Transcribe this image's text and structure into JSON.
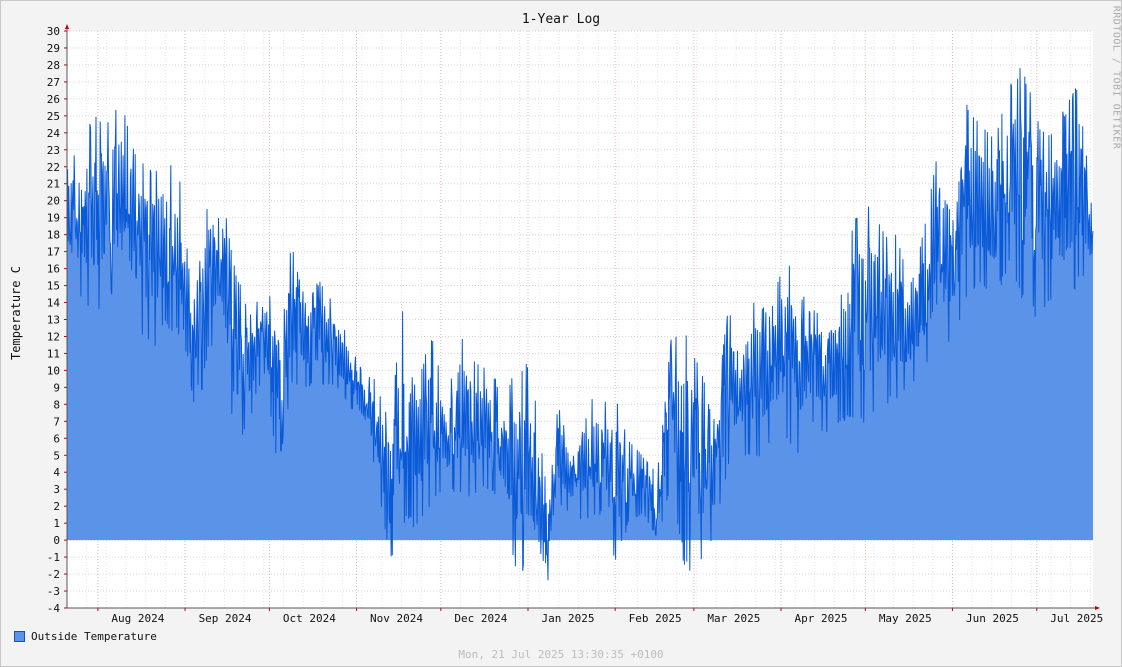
{
  "chart_data": {
    "type": "area",
    "title": "1-Year Log",
    "ylabel": "Temperature C",
    "xlabel": "",
    "ylim": [
      -4,
      30
    ],
    "yticks": [
      -4,
      -3,
      -2,
      -1,
      0,
      1,
      2,
      3,
      4,
      5,
      6,
      7,
      8,
      9,
      10,
      11,
      12,
      13,
      14,
      15,
      16,
      17,
      18,
      19,
      20,
      21,
      22,
      23,
      24,
      25,
      26,
      27,
      28,
      29,
      30
    ],
    "xlim": [
      "2024-07-21",
      "2025-07-21"
    ],
    "xticks": [
      {
        "label": "Aug 2024",
        "date": "2024-08-01"
      },
      {
        "label": "Sep 2024",
        "date": "2024-09-01"
      },
      {
        "label": "Oct 2024",
        "date": "2024-10-01"
      },
      {
        "label": "Nov 2024",
        "date": "2024-11-01"
      },
      {
        "label": "Dec 2024",
        "date": "2024-12-01"
      },
      {
        "label": "Jan 2025",
        "date": "2025-01-01"
      },
      {
        "label": "Feb 2025",
        "date": "2025-02-01"
      },
      {
        "label": "Mar 2025",
        "date": "2025-03-01"
      },
      {
        "label": "Apr 2025",
        "date": "2025-04-01"
      },
      {
        "label": "May 2025",
        "date": "2025-05-01"
      },
      {
        "label": "Jun 2025",
        "date": "2025-06-01"
      },
      {
        "label": "Jul 2025",
        "date": "2025-07-01"
      }
    ],
    "grid": true,
    "legend_position": "bottom-left",
    "series": [
      {
        "name": "Outside Temperature",
        "color": "#5b93e8",
        "line_color": "#0a5ad8",
        "points": [
          {
            "x": "2024-07-21",
            "min": 15.5,
            "max": 22.0
          },
          {
            "x": "2024-07-26",
            "min": 14.0,
            "max": 24.0
          },
          {
            "x": "2024-07-31",
            "min": 13.0,
            "max": 25.0
          },
          {
            "x": "2024-08-05",
            "min": 14.5,
            "max": 25.0
          },
          {
            "x": "2024-08-10",
            "min": 14.0,
            "max": 26.0
          },
          {
            "x": "2024-08-15",
            "min": 12.5,
            "max": 22.5
          },
          {
            "x": "2024-08-20",
            "min": 11.0,
            "max": 22.0
          },
          {
            "x": "2024-08-25",
            "min": 12.5,
            "max": 22.5
          },
          {
            "x": "2024-08-30",
            "min": 12.0,
            "max": 21.5
          },
          {
            "x": "2024-09-04",
            "min": 5.0,
            "max": 14.0
          },
          {
            "x": "2024-09-09",
            "min": 11.0,
            "max": 20.0
          },
          {
            "x": "2024-09-14",
            "min": 12.0,
            "max": 21.0
          },
          {
            "x": "2024-09-19",
            "min": 5.0,
            "max": 16.0
          },
          {
            "x": "2024-09-24",
            "min": 7.0,
            "max": 13.5
          },
          {
            "x": "2024-09-29",
            "min": 10.0,
            "max": 15.0
          },
          {
            "x": "2024-10-04",
            "min": 4.0,
            "max": 14.0
          },
          {
            "x": "2024-10-09",
            "min": 9.0,
            "max": 17.5
          },
          {
            "x": "2024-10-14",
            "min": 9.0,
            "max": 14.0
          },
          {
            "x": "2024-10-19",
            "min": 9.0,
            "max": 15.5
          },
          {
            "x": "2024-10-24",
            "min": 9.0,
            "max": 14.0
          },
          {
            "x": "2024-10-29",
            "min": 8.0,
            "max": 12.0
          },
          {
            "x": "2024-11-03",
            "min": 6.5,
            "max": 10.0
          },
          {
            "x": "2024-11-08",
            "min": 4.0,
            "max": 9.5
          },
          {
            "x": "2024-11-13",
            "min": -1.5,
            "max": 7.0
          },
          {
            "x": "2024-11-18",
            "min": 1.0,
            "max": 15.0
          },
          {
            "x": "2024-11-23",
            "min": 0.5,
            "max": 10.0
          },
          {
            "x": "2024-11-28",
            "min": 2.0,
            "max": 12.0
          },
          {
            "x": "2024-12-03",
            "min": 3.0,
            "max": 8.0
          },
          {
            "x": "2024-12-08",
            "min": 2.5,
            "max": 12.5
          },
          {
            "x": "2024-12-13",
            "min": 2.5,
            "max": 10.5
          },
          {
            "x": "2024-12-18",
            "min": 3.0,
            "max": 10.5
          },
          {
            "x": "2024-12-23",
            "min": 2.0,
            "max": 8.5
          },
          {
            "x": "2024-12-28",
            "min": -2.5,
            "max": 10.5
          },
          {
            "x": "2025-01-02",
            "min": -1.5,
            "max": 10.5
          },
          {
            "x": "2025-01-07",
            "min": -3.7,
            "max": 4.0
          },
          {
            "x": "2025-01-12",
            "min": 2.0,
            "max": 8.0
          },
          {
            "x": "2025-01-17",
            "min": 1.5,
            "max": 5.0
          },
          {
            "x": "2025-01-22",
            "min": 1.0,
            "max": 9.0
          },
          {
            "x": "2025-01-27",
            "min": 1.5,
            "max": 8.0
          },
          {
            "x": "2025-02-01",
            "min": -1.5,
            "max": 8.5
          },
          {
            "x": "2025-02-06",
            "min": 1.0,
            "max": 6.0
          },
          {
            "x": "2025-02-11",
            "min": 1.5,
            "max": 5.0
          },
          {
            "x": "2025-02-16",
            "min": 0.0,
            "max": 4.0
          },
          {
            "x": "2025-02-21",
            "min": 3.0,
            "max": 12.0
          },
          {
            "x": "2025-02-26",
            "min": -2.0,
            "max": 12.5
          },
          {
            "x": "2025-03-03",
            "min": -1.5,
            "max": 10.5
          },
          {
            "x": "2025-03-08",
            "min": 0.0,
            "max": 7.0
          },
          {
            "x": "2025-03-13",
            "min": 4.0,
            "max": 13.5
          },
          {
            "x": "2025-03-18",
            "min": 5.0,
            "max": 13.0
          },
          {
            "x": "2025-03-23",
            "min": 4.5,
            "max": 14.5
          },
          {
            "x": "2025-03-28",
            "min": 5.5,
            "max": 13.5
          },
          {
            "x": "2025-04-02",
            "min": 6.0,
            "max": 17.0
          },
          {
            "x": "2025-04-07",
            "min": 5.0,
            "max": 15.0
          },
          {
            "x": "2025-04-12",
            "min": 7.0,
            "max": 13.5
          },
          {
            "x": "2025-04-17",
            "min": 6.0,
            "max": 14.0
          },
          {
            "x": "2025-04-22",
            "min": 7.0,
            "max": 14.0
          },
          {
            "x": "2025-04-27",
            "min": 7.0,
            "max": 19.0
          },
          {
            "x": "2025-05-02",
            "min": 6.5,
            "max": 20.0
          },
          {
            "x": "2025-05-07",
            "min": 8.0,
            "max": 18.5
          },
          {
            "x": "2025-05-12",
            "min": 8.0,
            "max": 18.0
          },
          {
            "x": "2025-05-17",
            "min": 9.0,
            "max": 15.0
          },
          {
            "x": "2025-05-22",
            "min": 10.0,
            "max": 18.5
          },
          {
            "x": "2025-05-27",
            "min": 11.0,
            "max": 23.5
          },
          {
            "x": "2025-06-01",
            "min": 11.5,
            "max": 21.0
          },
          {
            "x": "2025-06-06",
            "min": 14.0,
            "max": 26.0
          },
          {
            "x": "2025-06-11",
            "min": 15.0,
            "max": 24.5
          },
          {
            "x": "2025-06-16",
            "min": 14.0,
            "max": 24.0
          },
          {
            "x": "2025-06-21",
            "min": 16.0,
            "max": 27.0
          },
          {
            "x": "2025-06-26",
            "min": 14.0,
            "max": 28.2
          },
          {
            "x": "2025-07-01",
            "min": 13.0,
            "max": 25.0
          },
          {
            "x": "2025-07-06",
            "min": 14.0,
            "max": 24.0
          },
          {
            "x": "2025-07-11",
            "min": 13.5,
            "max": 25.5
          },
          {
            "x": "2025-07-16",
            "min": 15.0,
            "max": 27.0
          },
          {
            "x": "2025-07-21",
            "min": 15.5,
            "max": 19.0
          }
        ]
      }
    ]
  },
  "watermark": "RRDTOOL / TOBI OETIKER",
  "timestamp": "Mon, 21 Jul 2025 13:30:35 +0100"
}
